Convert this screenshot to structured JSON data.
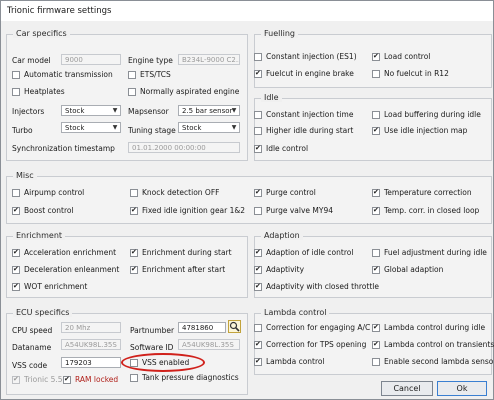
{
  "window": {
    "title": "Trionic firmware settings"
  },
  "groups": {
    "car": "Car specifics",
    "fuel": "Fuelling",
    "idle": "Idle",
    "misc": "Misc",
    "enrich": "Enrichment",
    "adapt": "Adaption",
    "ecu": "ECU specifics",
    "lambda": "Lambda control"
  },
  "car": {
    "car_model_label": "Car model",
    "car_model_value": "9000",
    "engine_type_label": "Engine type",
    "engine_type_value": "B234L-9000 C2...",
    "auto_trans": "Automatic transmission",
    "ets": "ETS/TCS",
    "heatplates": "Heatplates",
    "norm_asp": "Normally aspirated engine",
    "injectors_label": "Injectors",
    "injectors_value": "Stock",
    "mapsensor_label": "Mapsensor",
    "mapsensor_value": "2.5 bar sensor",
    "turbo_label": "Turbo",
    "turbo_value": "Stock",
    "tuning_label": "Tuning stage",
    "tuning_value": "Stock",
    "sync_label": "Synchronization timestamp",
    "sync_value": "01.01.2000 00:00:00"
  },
  "fuel": {
    "const_inj": "Constant injection (ES1)",
    "load_ctrl": "Load control",
    "fuelcut": "Fuelcut in engine brake",
    "nofuelcut": "No fuelcut in R12"
  },
  "idle": {
    "const_inj_time": "Constant injection time",
    "load_buf": "Load buffering during idle",
    "higher_idle": "Higher idle during start",
    "use_idle_inj": "Use idle injection map",
    "idle_ctrl": "Idle control"
  },
  "misc": {
    "airpump": "Airpump control",
    "knock": "Knock detection OFF",
    "purge": "Purge control",
    "temp_corr": "Temperature correction",
    "boost": "Boost control",
    "fixed_ign": "Fixed idle ignition gear 1&2",
    "purge_valve": "Purge valve MY94",
    "temp_closed": "Temp. corr. in closed loop"
  },
  "enrich": {
    "accel": "Acceleration enrichment",
    "decel": "Deceleration enleanment",
    "wot": "WOT enrichment",
    "during_start": "Enrichment during start",
    "after_start": "Enrichment after start"
  },
  "adapt": {
    "idle_ctrl": "Adaption of idle control",
    "fuel_adj": "Fuel adjustment during idle",
    "adaptivity": "Adaptivity",
    "global": "Global adaption",
    "closed_throttle": "Adaptivity with closed throttle"
  },
  "ecu": {
    "cpu_label": "CPU speed",
    "cpu_value": "20 Mhz",
    "partnumber_label": "Partnumber",
    "partnumber_value": "4781860",
    "dataname_label": "Dataname",
    "dataname_value": "A54UK98L.35S",
    "software_label": "Software ID",
    "software_value": "A54UK98L.35S",
    "vss_label": "VSS code",
    "vss_value": "179203",
    "vss_enabled": "VSS enabled",
    "trionic55": "Trionic 5.5",
    "ram_locked": "RAM locked",
    "tank_pressure": "Tank pressure diagnostics"
  },
  "lambda": {
    "corr_ac": "Correction for engaging A/C",
    "lambda_idle": "Lambda control during idle",
    "corr_tps": "Correction for TPS opening",
    "lambda_trans": "Lambda control on transients",
    "lambda_ctrl": "Lambda control",
    "second_lambda": "Enable second lambda sensor"
  },
  "buttons": {
    "cancel": "Cancel",
    "ok": "Ok"
  },
  "colors": {
    "highlight_ellipse": "#d0211b",
    "ram_locked_text": "#b0201a"
  }
}
